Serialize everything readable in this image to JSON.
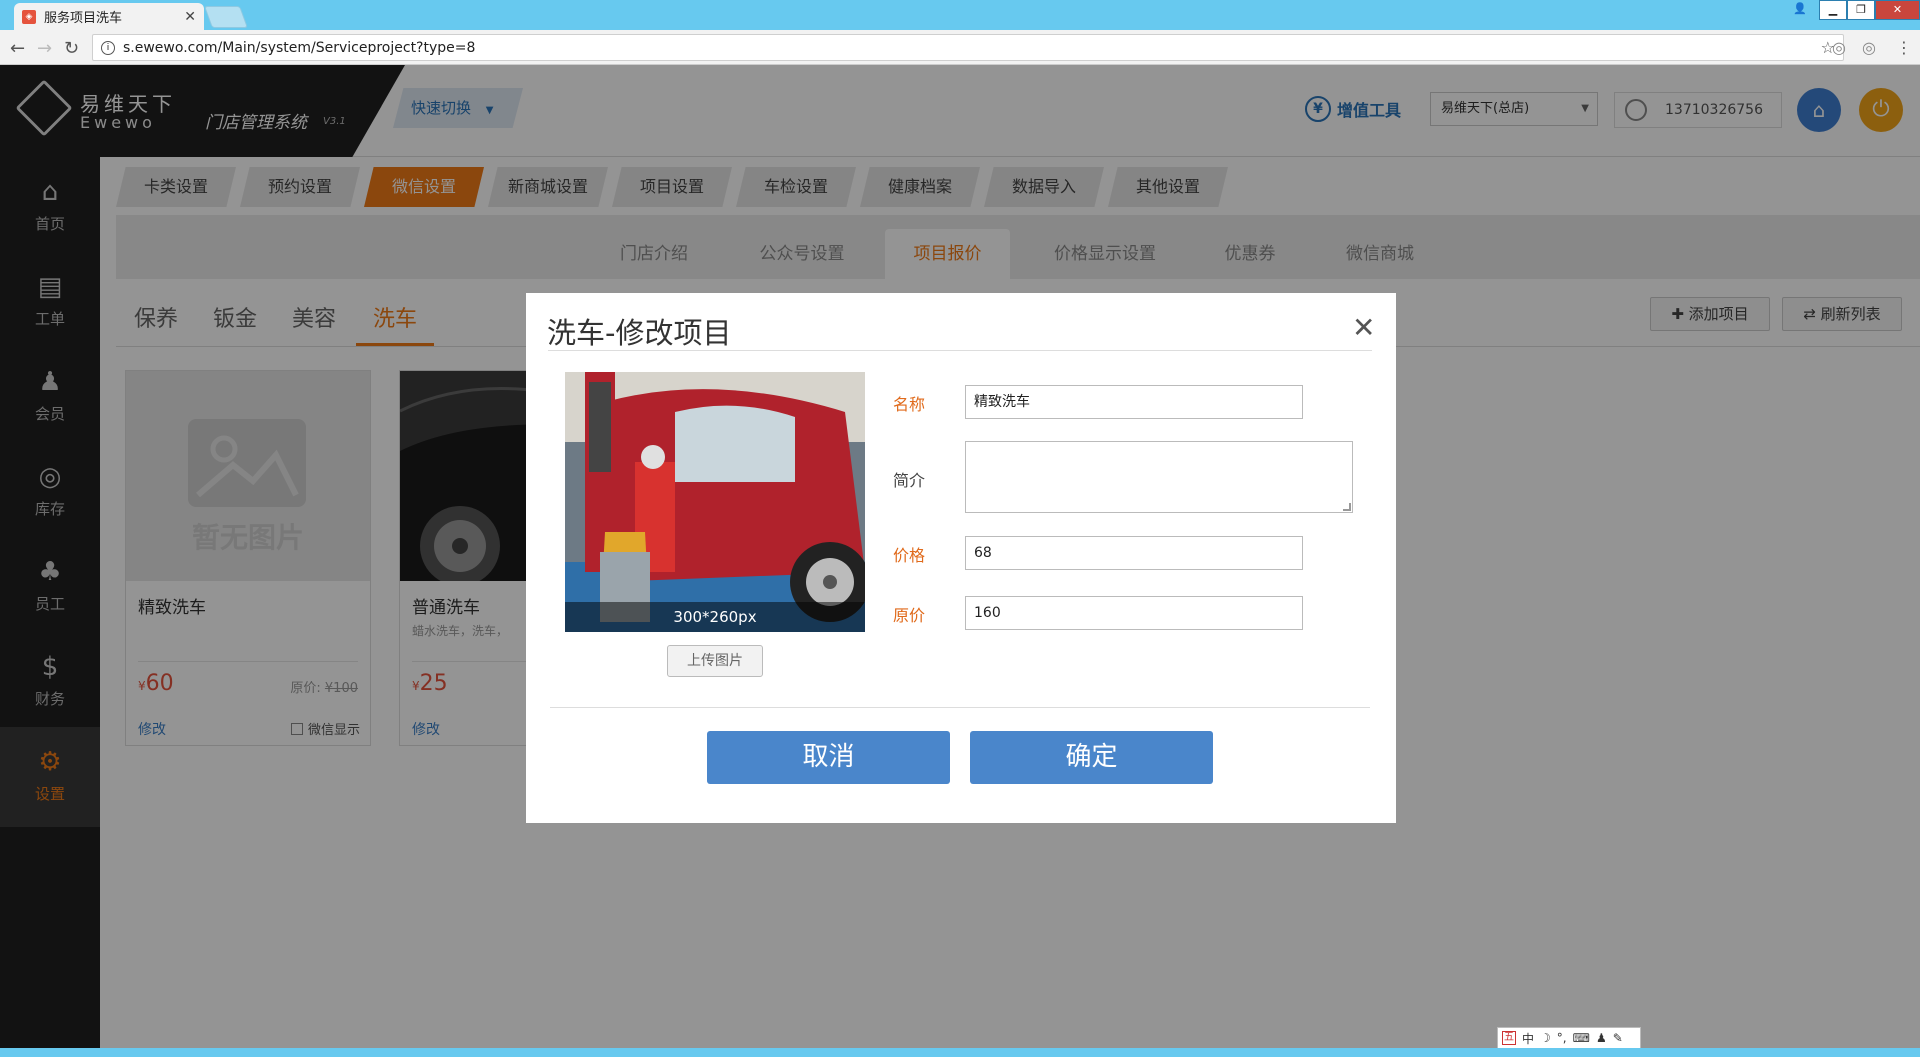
{
  "browser": {
    "tab_title": "服务项目洗车",
    "url": "s.ewewo.com/Main/system/Serviceproject?type=8"
  },
  "header": {
    "brand_cn": "易维天下",
    "brand_en": "Ewewo",
    "system_name": "门店管理系统",
    "version": "V3.1",
    "quick_switch": "快速切换",
    "value_tools": "增值工具",
    "store": "易维天下(总店)",
    "user_phone": "13710326756"
  },
  "sidebar": {
    "items": [
      {
        "label": "首页",
        "icon": "home-icon"
      },
      {
        "label": "工单",
        "icon": "work-order-icon"
      },
      {
        "label": "会员",
        "icon": "member-icon"
      },
      {
        "label": "库存",
        "icon": "inventory-icon"
      },
      {
        "label": "员工",
        "icon": "staff-icon"
      },
      {
        "label": "财务",
        "icon": "finance-icon"
      },
      {
        "label": "设置",
        "icon": "settings-icon"
      }
    ],
    "active": "设置"
  },
  "main_nav": [
    "卡类设置",
    "预约设置",
    "微信设置",
    "新商城设置",
    "项目设置",
    "车检设置",
    "健康档案",
    "数据导入",
    "其他设置"
  ],
  "main_nav_active": "微信设置",
  "sub_nav": [
    "门店介绍",
    "公众号设置",
    "项目报价",
    "价格显示设置",
    "优惠券",
    "微信商城"
  ],
  "sub_nav_active": "项目报价",
  "categories": [
    "保养",
    "钣金",
    "美容",
    "洗车"
  ],
  "category_active": "洗车",
  "toolbar": {
    "add_label": "添加项目",
    "refresh_label": "刷新列表"
  },
  "cards": [
    {
      "title": "精致洗车",
      "desc": "",
      "currency": "¥",
      "price": "60",
      "orig_label": "原价: ",
      "orig_price": "¥100",
      "edit": "修改",
      "wechat_show": "微信显示",
      "no_image_text": "暂无图片"
    },
    {
      "title": "普通洗车",
      "desc": "蜡水洗车，洗车，",
      "currency": "¥",
      "price": "25",
      "edit": "修改"
    }
  ],
  "modal": {
    "title": "洗车-修改项目",
    "image_caption": "300*260px",
    "upload_label": "上传图片",
    "fields": {
      "name_label": "名称",
      "name_value": "精致洗车",
      "desc_label": "简介",
      "desc_value": "",
      "price_label": "价格",
      "price_value": "68",
      "orig_label": "原价",
      "orig_value": "160"
    },
    "cancel_label": "取消",
    "confirm_label": "确定"
  },
  "ime": {
    "mode": "中"
  },
  "colors": {
    "accent": "#f07a18",
    "primary_button": "#4a86cb",
    "sidebar": "#1f1f1f",
    "chrome": "#67c9ef"
  }
}
